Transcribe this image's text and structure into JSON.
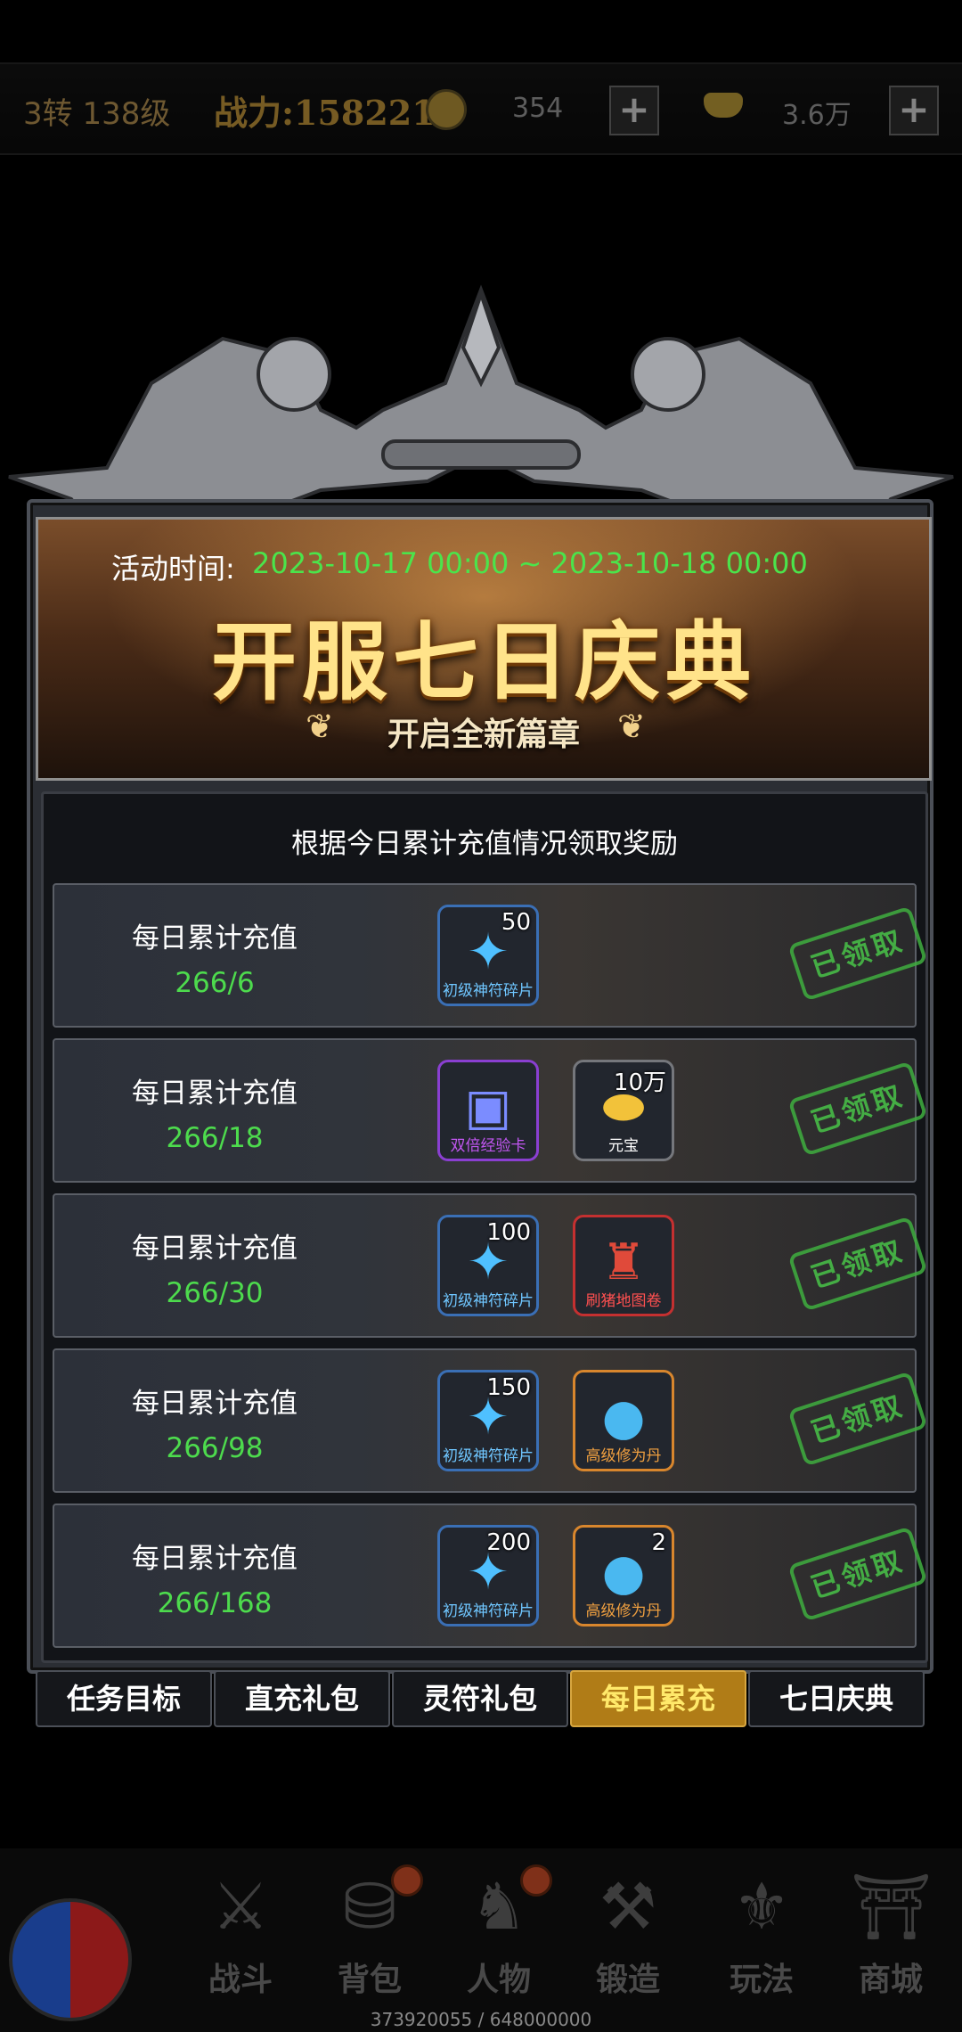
{
  "status_bar": {
    "level": "3转 138级",
    "power": "战力:158221",
    "coins": "354",
    "ingots": "3.6万",
    "plus": "+"
  },
  "banner": {
    "time_label": "活动时间:",
    "time_value": "2023-10-17 00:00 ~ 2023-10-18 00:00",
    "title": "开服七日庆典",
    "subtitle": "开启全新篇章"
  },
  "panel": {
    "hint": "根据今日累计充值情况领取奖励"
  },
  "rows": [
    {
      "label": "每日累计充值",
      "progress": "266/6",
      "status": "已领取",
      "items": [
        {
          "name": "初级神符碎片",
          "count": "50"
        }
      ]
    },
    {
      "label": "每日累计充值",
      "progress": "266/18",
      "status": "已领取",
      "items": [
        {
          "name": "双倍经验卡",
          "count": ""
        },
        {
          "name": "元宝",
          "count": "10万"
        }
      ]
    },
    {
      "label": "每日累计充值",
      "progress": "266/30",
      "status": "已领取",
      "items": [
        {
          "name": "初级神符碎片",
          "count": "100"
        },
        {
          "name": "刷猪地图卷",
          "count": ""
        }
      ]
    },
    {
      "label": "每日累计充值",
      "progress": "266/98",
      "status": "已领取",
      "items": [
        {
          "name": "初级神符碎片",
          "count": "150"
        },
        {
          "name": "高级修为丹",
          "count": ""
        }
      ]
    },
    {
      "label": "每日累计充值",
      "progress": "266/168",
      "status": "已领取",
      "items": [
        {
          "name": "初级神符碎片",
          "count": "200"
        },
        {
          "name": "高级修为丹",
          "count": "2"
        }
      ]
    }
  ],
  "tabs": [
    "任务目标",
    "直充礼包",
    "灵符礼包",
    "每日累充",
    "七日庆典"
  ],
  "bottom_nav": [
    "战斗",
    "背包",
    "人物",
    "锻造",
    "玩法",
    "商城"
  ],
  "exp": "373920055 / 648000000"
}
